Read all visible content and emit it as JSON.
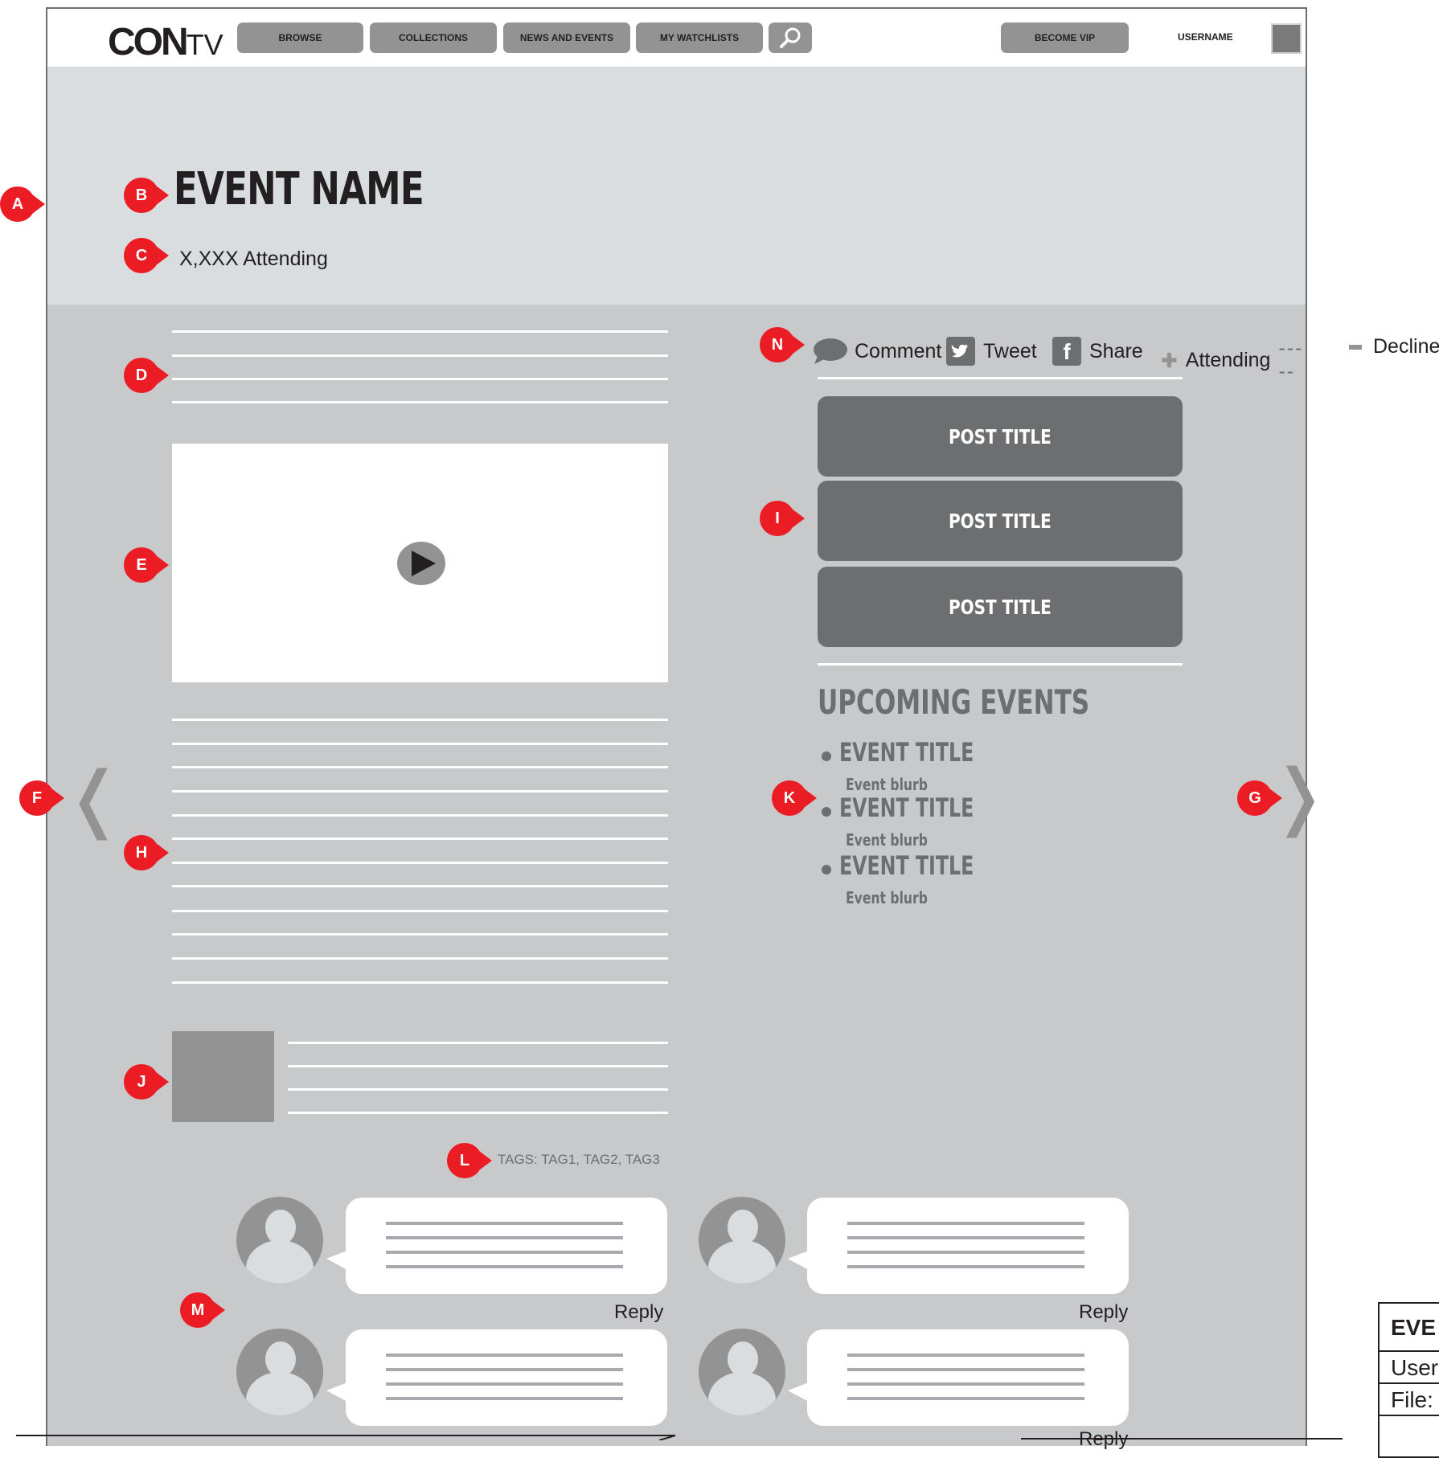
{
  "logo": {
    "con": "CON",
    "tv": "TV"
  },
  "nav": {
    "browse": "BROWSE",
    "collections": "COLLECTIONS",
    "news_events": "NEWS AND EVENTS",
    "watchlists": "MY WATCHLISTS",
    "become_vip": "BECOME VIP",
    "username": "USERNAME"
  },
  "event": {
    "name": "EVENT NAME",
    "attending": "X,XXX Attending"
  },
  "social": {
    "comment": "Comment",
    "tweet": "Tweet",
    "share": "Share",
    "attending": "Attending",
    "decline": "Decline"
  },
  "posts": [
    "POST TITLE",
    "POST TITLE",
    "POST TITLE"
  ],
  "upcoming": {
    "heading": "UPCOMING EVENTS",
    "events": [
      {
        "title": "EVENT TITLE",
        "blurb": "Event blurb"
      },
      {
        "title": "EVENT TITLE",
        "blurb": "Event blurb"
      },
      {
        "title": "EVENT TITLE",
        "blurb": "Event blurb"
      }
    ]
  },
  "tags": "TAGS: TAG1, TAG2, TAG3",
  "comments": {
    "reply": "Reply"
  },
  "markers": [
    "A",
    "B",
    "C",
    "D",
    "E",
    "F",
    "G",
    "H",
    "I",
    "J",
    "K",
    "L",
    "M",
    "N"
  ],
  "legend": {
    "title": "EVE",
    "user": "User",
    "file": "File:"
  },
  "colors": {
    "accent": "#ec1c24",
    "button": "#939393",
    "post": "#6d6e70",
    "hero": "#d9dddf",
    "body": "#c8c9cb"
  }
}
